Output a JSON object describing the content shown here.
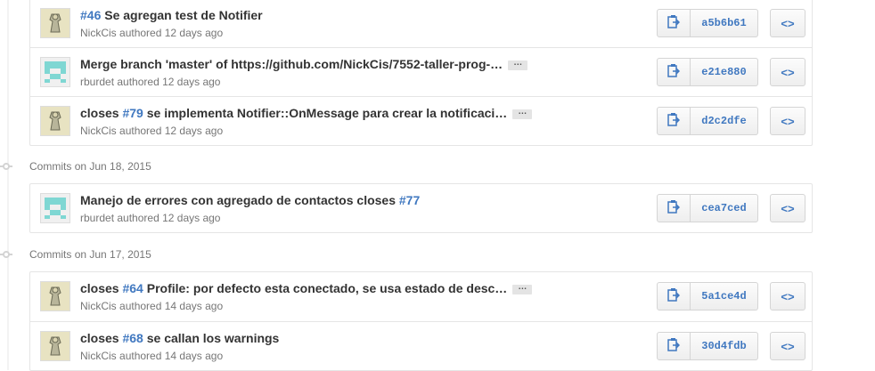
{
  "groups": [
    {
      "header": "",
      "commits": [
        {
          "issue": "#46",
          "title_text": " Se agregan test de Notifier",
          "prefix": "",
          "author": "NickCis",
          "authored": "authored",
          "time": "12 days ago",
          "sha": "a5b6b61",
          "avatar": "nickcis",
          "ellipsis": false
        },
        {
          "issue": "",
          "prefix": "",
          "title_text": "Merge branch 'master' of https://github.com/NickCis/7552-taller-prog-…",
          "author": "rburdet",
          "authored": "authored",
          "time": "12 days ago",
          "sha": "e21e880",
          "avatar": "rburdet",
          "ellipsis": true
        },
        {
          "issue": "#79",
          "prefix": "closes ",
          "title_text": " se implementa Notifier::OnMessage para crear la notificaci…",
          "author": "NickCis",
          "authored": "authored",
          "time": "12 days ago",
          "sha": "d2c2dfe",
          "avatar": "nickcis",
          "ellipsis": true
        }
      ]
    },
    {
      "header_label": "Commits",
      "header_on": "on Jun 18, 2015",
      "commits": [
        {
          "issue": "#77",
          "prefix": "",
          "title_text": "Manejo de errores con agregado de contactos closes ",
          "author": "rburdet",
          "authored": "authored",
          "time": "12 days ago",
          "sha": "cea7ced",
          "avatar": "rburdet",
          "ellipsis": false
        }
      ]
    },
    {
      "header_label": "Commits",
      "header_on": "on Jun 17, 2015",
      "commits": [
        {
          "issue": "#64",
          "prefix": "closes ",
          "title_text": " Profile: por defecto esta conectado, se usa estado de desc…",
          "author": "NickCis",
          "authored": "authored",
          "time": "14 days ago",
          "sha": "5a1ce4d",
          "avatar": "nickcis",
          "ellipsis": true
        },
        {
          "issue": "#68",
          "prefix": "closes ",
          "title_text": " se callan los warnings",
          "author": "NickCis",
          "authored": "authored",
          "time": "14 days ago",
          "sha": "30d4fdb",
          "avatar": "nickcis",
          "ellipsis": false
        }
      ]
    }
  ],
  "icons": {
    "copy": "clipboard-icon",
    "browse": "code-icon",
    "ellipsis": "ellipsis-icon"
  },
  "colors": {
    "link": "#4078c0",
    "muted": "#767676",
    "border": "#e5e5e5",
    "identicon": "#7fd7d3"
  },
  "ellipsis_text": "…"
}
